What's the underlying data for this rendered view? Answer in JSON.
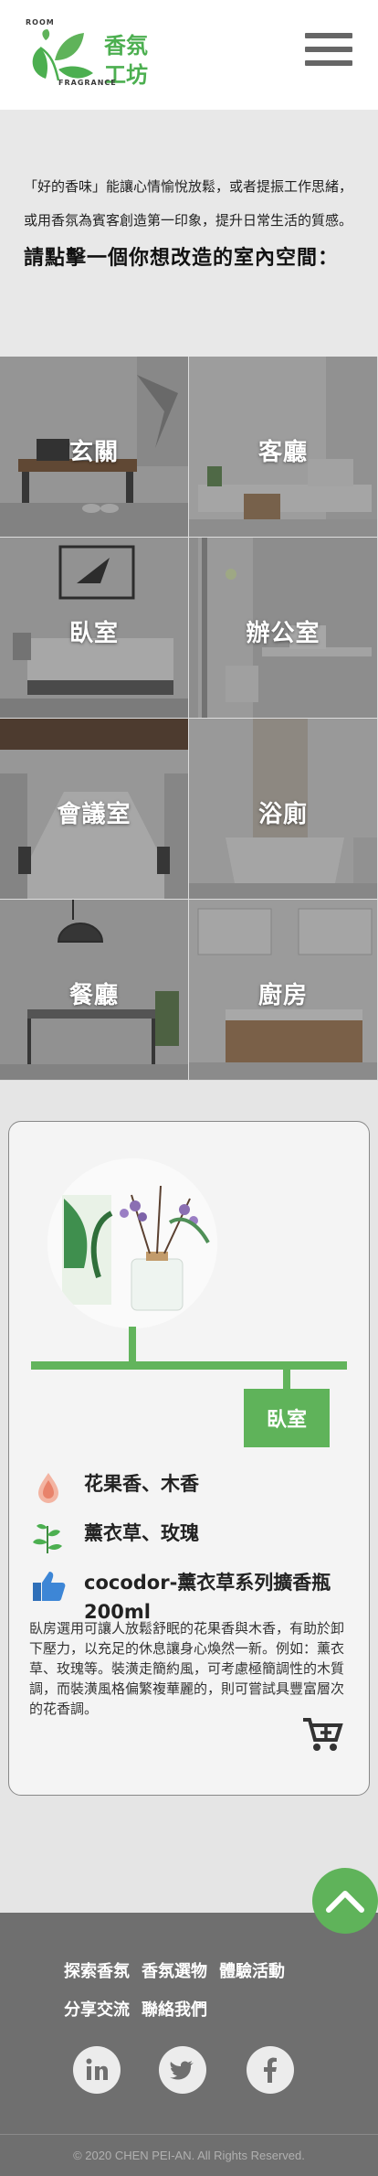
{
  "header": {
    "logo": {
      "room": "ROOM",
      "fragrance": "FRAGRANCE",
      "cn_line1": "香氛",
      "cn_line2": "工坊"
    },
    "menu_icon": "hamburger-menu-icon"
  },
  "intro": {
    "text": "「好的香味」能讓心情愉悅放鬆，或者提振工作思緒，或用香氛為賓客創造第一印象，提升日常生活的質感。",
    "heading": "請點擊一個你想改造的室內空間："
  },
  "rooms": [
    {
      "label": "玄關"
    },
    {
      "label": "客廳"
    },
    {
      "label": "臥室"
    },
    {
      "label": "辦公室"
    },
    {
      "label": "會議室"
    },
    {
      "label": "浴廁"
    },
    {
      "label": "餐廳"
    },
    {
      "label": "廚房"
    }
  ],
  "product": {
    "room_tag": "臥室",
    "features": [
      {
        "icon": "scent-drop-icon",
        "text": "花果香、木香"
      },
      {
        "icon": "herb-leaf-icon",
        "text": "薰衣草、玫瑰"
      },
      {
        "icon": "thumbs-up-icon",
        "text": "cocodor-薰衣草系列擴香瓶 200ml"
      }
    ],
    "description": "臥房選用可讓人放鬆舒眠的花果香與木香，有助於卸下壓力，以充足的休息讓身心煥然一新。例如：薰衣草、玫瑰等。裝潢走簡約風，可考慮極簡調性的木質調，而裝潢風格偏繁複華麗的，則可嘗試具豐富層次的花香調。",
    "cart_icon": "add-to-cart-icon"
  },
  "back_to_top_icon": "chevron-up-icon",
  "footer": {
    "nav": [
      "探索香氛",
      "香氛選物",
      "體驗活動",
      "分享交流",
      "聯絡我們"
    ],
    "social": [
      "linkedin-icon",
      "twitter-icon",
      "facebook-icon"
    ],
    "copyright": "© 2020 CHEN PEI-AN. All Rights Reserved."
  },
  "colors": {
    "brand_green": "#5fb35a",
    "footer_bg": "#6f6f6f",
    "page_bg": "#e5e5e5"
  }
}
